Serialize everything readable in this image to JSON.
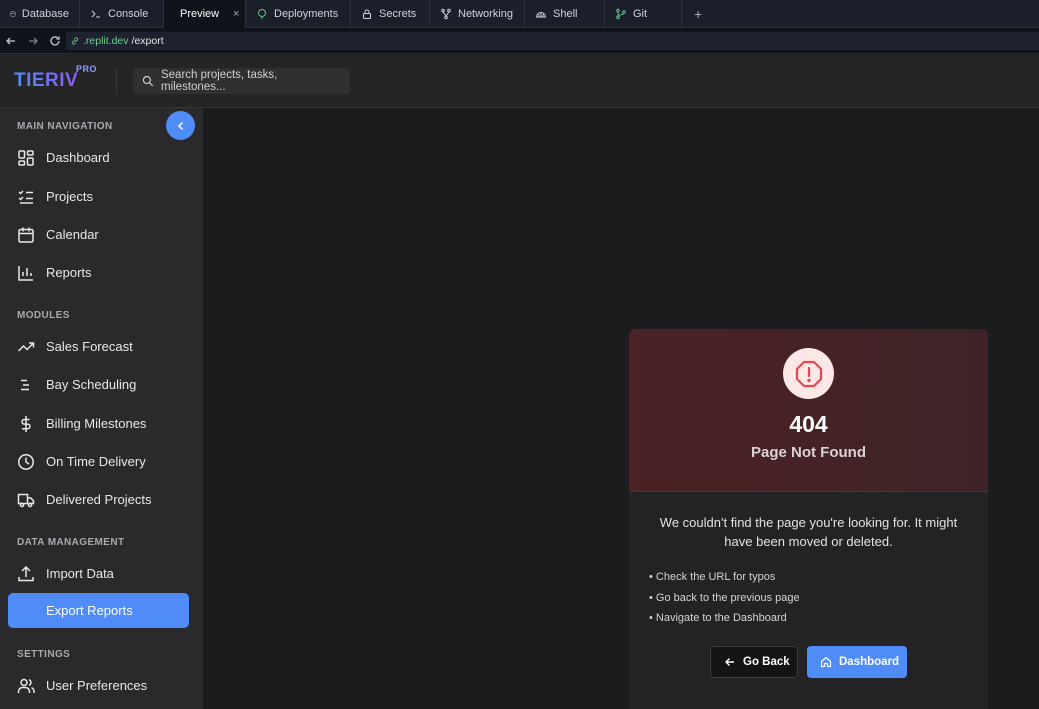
{
  "ide_tabs": [
    {
      "label": "Database",
      "icon": "database-icon"
    },
    {
      "label": "Console",
      "icon": "terminal-icon"
    },
    {
      "label": "Preview",
      "icon": "monitor-icon",
      "active": true
    },
    {
      "label": "Deployments",
      "icon": "rocket-icon"
    },
    {
      "label": "Secrets",
      "icon": "lock-icon"
    },
    {
      "label": "Networking",
      "icon": "network-icon"
    },
    {
      "label": "Shell",
      "icon": "shell-icon"
    },
    {
      "label": "Git",
      "icon": "git-branch-icon"
    }
  ],
  "tab_close": "×",
  "tab_add": "+",
  "url": {
    "host": ".replit.dev",
    "path": "/export"
  },
  "app": {
    "logo": "TIERIV",
    "badge": "PRO"
  },
  "search": {
    "placeholder": "Search projects, tasks, milestones..."
  },
  "sidebar": {
    "sections": [
      {
        "title": "MAIN NAVIGATION"
      },
      {
        "title": "MODULES"
      },
      {
        "title": "DATA MANAGEMENT"
      },
      {
        "title": "SETTINGS"
      }
    ],
    "items": [
      {
        "label": "Dashboard",
        "icon": "grid-icon"
      },
      {
        "label": "Projects",
        "icon": "checklist-icon"
      },
      {
        "label": "Calendar",
        "icon": "calendar-icon"
      },
      {
        "label": "Reports",
        "icon": "bar-chart-icon"
      },
      {
        "label": "Sales Forecast",
        "icon": "trending-up-icon"
      },
      {
        "label": "Bay Scheduling",
        "icon": "align-icon"
      },
      {
        "label": "Billing Milestones",
        "icon": "dollar-icon"
      },
      {
        "label": "On Time Delivery",
        "icon": "clock-icon"
      },
      {
        "label": "Delivered Projects",
        "icon": "truck-icon"
      },
      {
        "label": "Import Data",
        "icon": "upload-icon"
      },
      {
        "label": "Export Reports",
        "icon": "download-icon",
        "active": true
      },
      {
        "label": "User Preferences",
        "icon": "users-icon"
      }
    ]
  },
  "error": {
    "code": "404",
    "title": "Page Not Found",
    "message": "We couldn't find the page you're looking for. It might have been moved or deleted.",
    "tips": [
      "• Check the URL for typos",
      "• Go back to the previous page",
      "• Navigate to the Dashboard"
    ],
    "back_label": "Go Back",
    "dashboard_label": "Dashboard"
  },
  "colors": {
    "accent": "#4f8cf7",
    "error_bg": "#4b2225",
    "error_icon": "#e5484d"
  }
}
